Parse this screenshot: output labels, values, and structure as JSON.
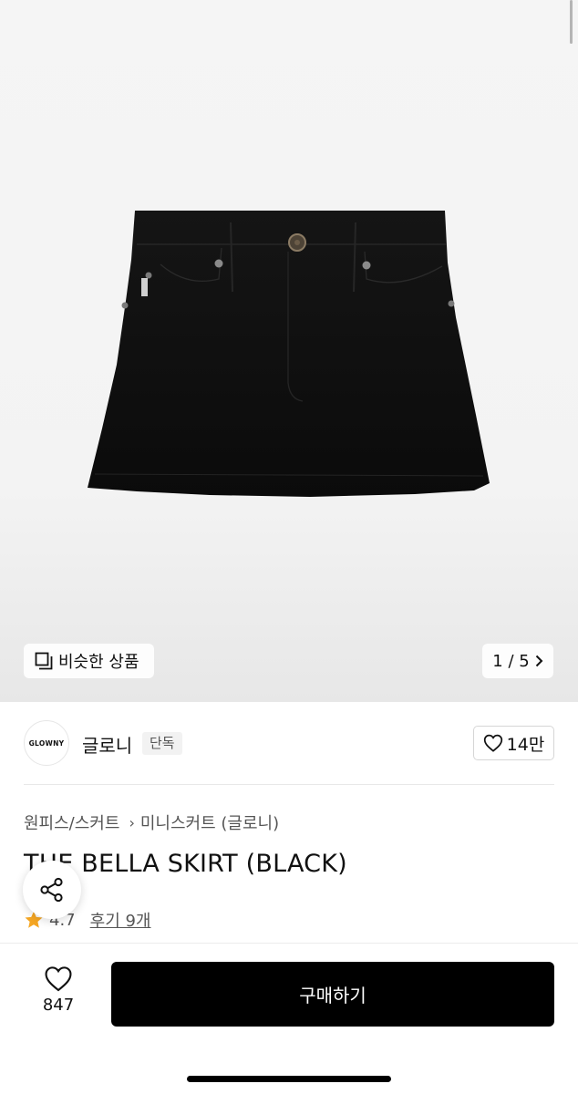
{
  "image_carousel": {
    "similar_products_label": "비슷한 상품",
    "counter": "1 / 5"
  },
  "brand": {
    "logo_text": "GLOWNY",
    "name": "글로니",
    "badge": "단독"
  },
  "likes": {
    "count": "14만"
  },
  "breadcrumb": {
    "category": "원피스/스커트",
    "subcategory": "미니스커트 (글로니)"
  },
  "product": {
    "title": "THE BELLA SKIRT (BLACK)",
    "rating": "4.7",
    "reviews_label": "후기 9개"
  },
  "bottom_bar": {
    "wish_count": "847",
    "buy_label": "구매하기"
  },
  "colors": {
    "buy_button": "#000000",
    "star": "#f5a623"
  },
  "icons": {
    "similar": "copy-icon",
    "counter": "chevron-right-icon",
    "likes": "heart-icon",
    "share": "share-icon",
    "rating": "star-icon",
    "wish": "heart-icon"
  }
}
